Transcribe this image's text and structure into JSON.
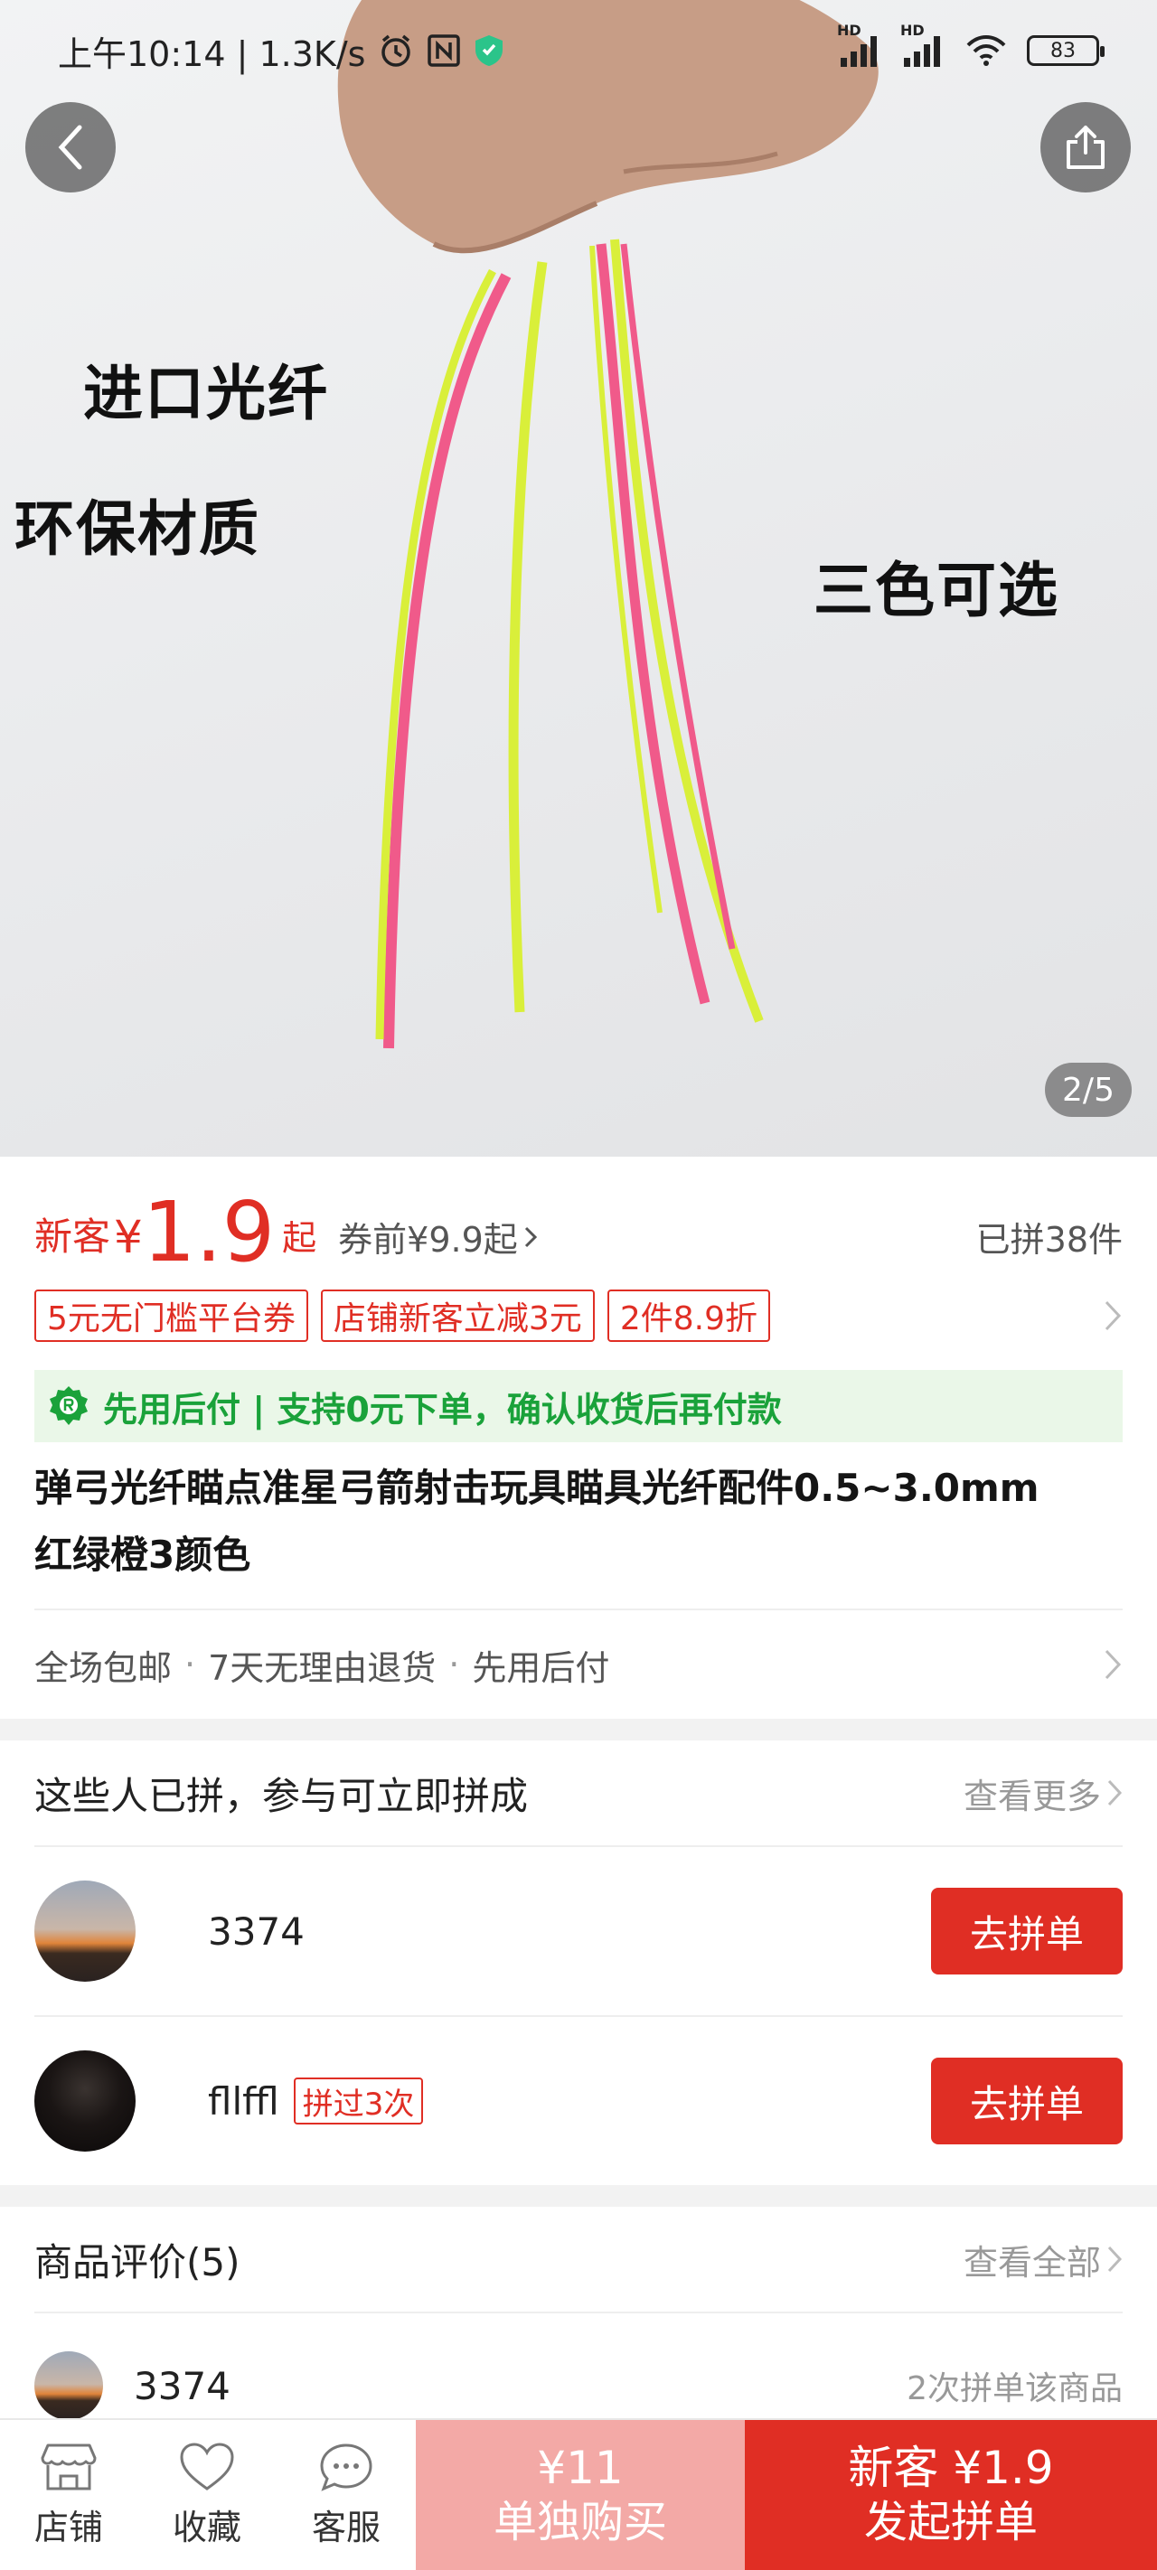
{
  "status_bar": {
    "time_speed": "上午10:14 | 1.3K/s",
    "signal1_badge": "HD",
    "signal2_badge": "HD",
    "battery": "83"
  },
  "gallery": {
    "overlay_texts": [
      "进口光纤",
      "环保材质",
      "三色可选"
    ],
    "counter": "2/5"
  },
  "price": {
    "new_customer_label": "新客",
    "currency": "¥",
    "value": "1.9",
    "suffix": "起",
    "before_coupon": "券前¥9.9起",
    "sold": "已拼38件"
  },
  "coupons": [
    "5元无门槛平台券",
    "店铺新客立减3元",
    "2件8.9折"
  ],
  "pay_later": {
    "text": "先用后付 | 支持0元下单，确认收货后再付款"
  },
  "product": {
    "title_line1": "弹弓光纤瞄点准星弓箭射击玩具瞄具光纤配件0.5~3.0mm",
    "title_line2": "红绿橙3颜色"
  },
  "services": {
    "items": [
      "全场包邮",
      "7天无理由退货",
      "先用后付"
    ],
    "separator": "·"
  },
  "group_section": {
    "title": "这些人已拼，参与可立即拼成",
    "more": "查看更多",
    "groups": [
      {
        "name": "3374",
        "tag": "",
        "button": "去拼单"
      },
      {
        "name": "fllffl",
        "tag": "拼过3次",
        "button": "去拼单"
      }
    ]
  },
  "reviews": {
    "title": "商品评价(5)",
    "more": "查看全部",
    "first": {
      "name": "3374",
      "meta": "2次拼单该商品"
    }
  },
  "bottom_bar": {
    "store": "店铺",
    "favorite": "收藏",
    "service": "客服",
    "alone_price": "¥11",
    "alone_label": "单独购买",
    "group_price": "新客 ¥1.9",
    "group_label": "发起拼单"
  },
  "colors": {
    "accent": "#e02e24",
    "accent_light": "#f3a9a6",
    "green": "#1aa23a",
    "green_bg": "#eaf7e8"
  }
}
